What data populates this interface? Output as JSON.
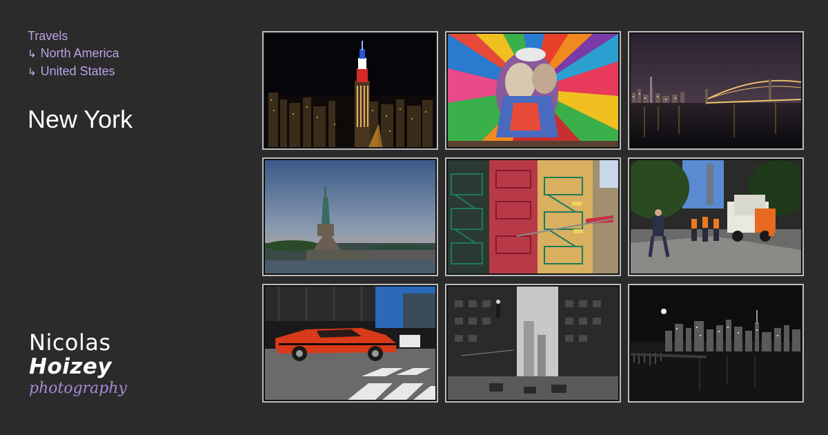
{
  "breadcrumb": {
    "items": [
      {
        "label": "Travels",
        "arrow": ""
      },
      {
        "label": "North America",
        "arrow": "↳"
      },
      {
        "label": "United States",
        "arrow": "↳"
      }
    ]
  },
  "page_title": "New York",
  "logo": {
    "first": "Nicolas",
    "last": "Hoizey",
    "sub": "photography"
  },
  "colors": {
    "background": "#2b2b2b",
    "accent": "#b9a2e6",
    "thumb_border": "#bdbdbd"
  },
  "gallery": [
    {
      "name": "empire-state-night-photo"
    },
    {
      "name": "colorful-mural-photo"
    },
    {
      "name": "brooklyn-bridge-night-photo"
    },
    {
      "name": "statue-of-liberty-photo"
    },
    {
      "name": "fire-escapes-photo"
    },
    {
      "name": "street-workers-photo"
    },
    {
      "name": "red-muscle-car-photo"
    },
    {
      "name": "bw-avenue-photo"
    },
    {
      "name": "bw-skyline-night-photo"
    }
  ]
}
